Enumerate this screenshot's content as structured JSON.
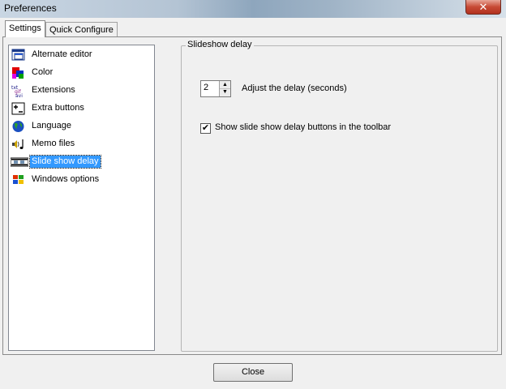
{
  "window": {
    "title": "Preferences",
    "close_glyph": "✕"
  },
  "tabs": [
    {
      "label": "Settings",
      "selected": true
    },
    {
      "label": "Quick Configure",
      "selected": false
    }
  ],
  "sidebar": {
    "items": [
      {
        "label": "Alternate editor",
        "icon": "editor-window-icon"
      },
      {
        "label": "Color",
        "icon": "color-palette-icon"
      },
      {
        "label": "Extensions",
        "icon": "file-extensions-icon"
      },
      {
        "label": "Extra buttons",
        "icon": "extra-buttons-icon"
      },
      {
        "label": "Language",
        "icon": "globe-icon"
      },
      {
        "label": "Memo files",
        "icon": "sound-note-icon"
      },
      {
        "label": "Slide show delay",
        "icon": "film-strip-icon",
        "selected": true
      },
      {
        "label": "Windows options",
        "icon": "windows-logo-icon"
      }
    ]
  },
  "panel": {
    "group_title": "Slideshow delay",
    "delay_value": "2",
    "delay_label": "Adjust the delay (seconds)",
    "toolbar_checkbox_label": "Show slide show delay buttons in the toolbar",
    "toolbar_checkbox_checked": true,
    "check_glyph": "✔",
    "spin_up_glyph": "▲",
    "spin_down_glyph": "▼"
  },
  "footer": {
    "close_label": "Close"
  }
}
